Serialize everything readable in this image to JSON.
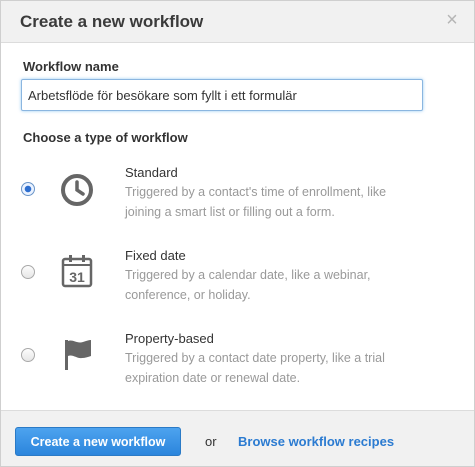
{
  "header": {
    "title": "Create a new workflow",
    "close_symbol": "×"
  },
  "form": {
    "name_label": "Workflow name",
    "name_value": "Arbetsflöde för besökare som fyllt i ett formulär",
    "type_label": "Choose a type of workflow"
  },
  "options": [
    {
      "title": "Standard",
      "description": "Triggered by a contact's time of enrollment, like joining a smart list or filling out a form.",
      "icon": "clock-icon",
      "selected": true
    },
    {
      "title": "Fixed date",
      "description": "Triggered by a calendar date, like a webinar, conference, or holiday.",
      "icon": "calendar-icon",
      "calendar_day": "31",
      "selected": false
    },
    {
      "title": "Property-based",
      "description": "Triggered by a contact date property, like a trial expiration date or renewal date.",
      "icon": "flag-icon",
      "selected": false
    }
  ],
  "footer": {
    "create_label": "Create a new workflow",
    "or_text": "or",
    "browse_label": "Browse workflow recipes"
  },
  "colors": {
    "accent": "#2b85dc",
    "link": "#2b7bd1",
    "icon": "#666666"
  }
}
